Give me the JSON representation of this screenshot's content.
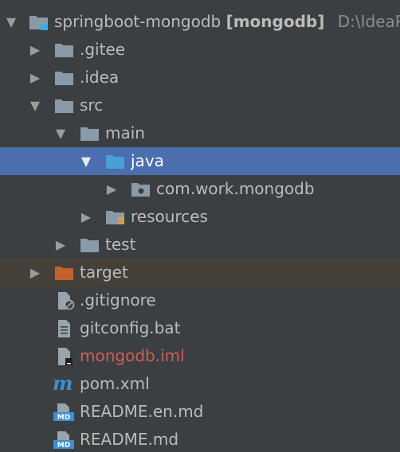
{
  "project": {
    "name": "springboot-mongodb",
    "module": "[mongodb]",
    "path": "D:\\IdeaP"
  },
  "items": {
    "gitee": ".gitee",
    "idea": ".idea",
    "src": "src",
    "main": "main",
    "java": "java",
    "package": "com.work.mongodb",
    "resources": "resources",
    "test": "test",
    "target": "target",
    "gitignore": ".gitignore",
    "gitconfig": "gitconfig.bat",
    "iml": "mongodb.iml",
    "pom": "pom.xml",
    "readme_en": "README.en.md",
    "readme": "README.md"
  },
  "colors": {
    "background": "#3c3f41",
    "selection": "#4b6eaf",
    "excluded_row": "#45403a",
    "folder": "#8a9aa6",
    "source_folder": "#4a9fd8",
    "excluded_folder": "#c2622d",
    "iml_text": "#cc5f5a",
    "maven_icon": "#3d8fd1"
  },
  "icons": {
    "expanded": "triangle-down-icon",
    "collapsed": "triangle-right-icon",
    "module": "module-folder-icon",
    "folder": "folder-icon",
    "source_root": "source-folder-icon",
    "package": "package-icon",
    "resources": "resources-folder-icon",
    "excluded": "excluded-folder-icon",
    "ignore_file": "ignore-file-icon",
    "text_file": "text-file-icon",
    "iml_file": "iml-file-icon",
    "maven": "maven-icon",
    "markdown": "markdown-file-icon"
  }
}
